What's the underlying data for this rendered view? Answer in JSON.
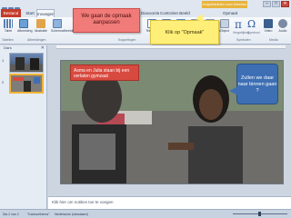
{
  "window": {
    "context_tab": "Hulpmiddelen voor tekenen",
    "min": "–",
    "max": "□",
    "close": "✕"
  },
  "ribbon_tabs": {
    "file": "Bestand",
    "start": "Start",
    "insert": "Invoegen",
    "design": "Ontwerpen",
    "transitions": "Overgangen",
    "animations": "Animaties",
    "slideshow": "Diavoorstelling",
    "review": "Controleren",
    "view": "Beeld",
    "format": "Opmaak"
  },
  "ribbon": {
    "table": "Tabel",
    "picture": "Afbeelding",
    "clipart": "Illustratie",
    "screenshot": "Schermafbeelding",
    "textbox": "Tekstvak",
    "header_footer": "Koptekst",
    "wordart": "WordArt",
    "date_time": "Datum",
    "slide_number": "Dianummer",
    "object": "Object",
    "equation_symbol": "π",
    "symbol_symbol": "Ω",
    "equation": "Vergelijking",
    "symbol": "Symbool",
    "video": "Video",
    "audio": "Audio",
    "group_tables": "Tabellen",
    "group_images": "Afbeeldingen",
    "group_links": "Koppelingen",
    "group_text": "Tekst",
    "group_symbols": "Symbolen",
    "group_media": "Media"
  },
  "tutorial": {
    "red_note": "We gaan de opmaak\naanpassen",
    "yellow_note": "Klik op \"Opmaak\""
  },
  "slides_panel": {
    "tab_slides": "Dia's",
    "tab_overview": "Overzicht",
    "close": "✕",
    "thumb_numbers": [
      "1",
      "2"
    ]
  },
  "slide": {
    "bubble_red": "Asma en Julia staan bij een verlaten gymzaal",
    "bubble_blue": "Zullen we daar naar binnen gaan ?"
  },
  "notes": {
    "placeholder": "Klik hier om notities toe te voegen"
  },
  "statusbar": {
    "slide_info": "Dia 2 van 2",
    "theme": "\"Kantoorthema\"",
    "language": "Nederlands (standaard)"
  },
  "colors": {
    "file_tab": "#c43b2a",
    "context_tab": "#e8b43c",
    "red_note": "#f07b78",
    "yellow_note": "#ffef78",
    "slide_red_bubble": "#d84a3f",
    "slide_blue_bubble": "#3e6fb4"
  }
}
